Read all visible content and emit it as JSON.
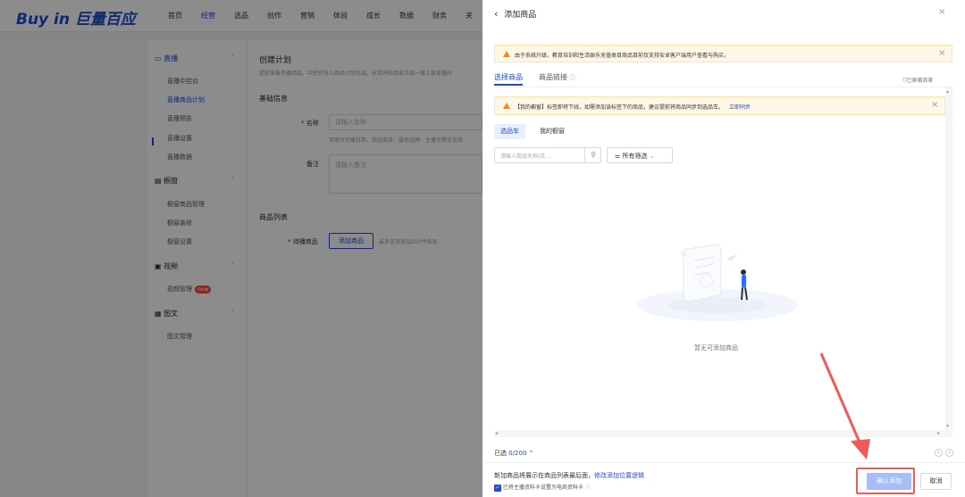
{
  "app": {
    "logo": "Buy in 巨量百应"
  },
  "nav": {
    "items": [
      "首页",
      "经营",
      "选品",
      "创作",
      "营销",
      "体验",
      "成长",
      "数据",
      "财务",
      "关"
    ],
    "active_index": 1
  },
  "sidebar": {
    "groups": [
      {
        "label": "直播",
        "items": [
          "直播中控台",
          "直播商品计划",
          "直播预告",
          "直播设置",
          "直播数据"
        ]
      },
      {
        "label": "橱窗",
        "items": [
          "橱窗商品管理",
          "橱窗装修",
          "橱窗设置"
        ]
      },
      {
        "label": "视频",
        "items": [
          "视频管理"
        ],
        "badge": "new"
      },
      {
        "label": "图文",
        "items": [
          "图文管理"
        ]
      }
    ],
    "active_item": "直播商品计划"
  },
  "main": {
    "title": "创建计划",
    "subtitle": "提前准备待播商品，中控台导入商品计划包或，支持将商品依次或一键上架直播间",
    "basic_section": "基础信息",
    "name_label": "* 名称",
    "name_placeholder": "请输入名称",
    "name_hint": "可填写开播日期、商品类目、服务品牌、主播名等信息供",
    "note_label": "备注",
    "note_placeholder": "请输入备注",
    "list_section": "商品列表",
    "pending_label": "* 待播商品",
    "add_button": "添加商品",
    "add_hint": "最多支持添加200件商品"
  },
  "drawer": {
    "back_label": "添加商品",
    "notice": "由于系统升级，教育培训和生活娱乐充值类目商品目前仅支持安卓客户端用户查看与购买。",
    "tabs": [
      "选择商品",
      "商品链接"
    ],
    "active_tab": "选择商品",
    "shielded": "已屏蔽商家",
    "warning": "【我的橱窗】标签即将下线，如需添加该标签下的商品，建议提前将商品同步到选品车。",
    "warning_link": "立即同步",
    "sub_tabs": [
      "选品车",
      "我的橱窗"
    ],
    "active_sub_tab": "选品车",
    "search_placeholder": "请输入商品名称/店...",
    "filter_label": "所有筛选",
    "empty_text": "暂无可添加商品",
    "selected_label": "已选",
    "selected_count": "0/200",
    "footer_note": "新加商品将展示在商品列表最后面，",
    "footer_link": "修改添加位置逻辑",
    "checkbox_label": "已将主播资料卡设置为电商资料卡",
    "checkbox_checked": true,
    "confirm_button": "确认添加",
    "cancel_button": "取消"
  },
  "colors": {
    "brand": "#1d4dd1",
    "warning": "#ff8800",
    "annotation": "#f05a5a"
  }
}
